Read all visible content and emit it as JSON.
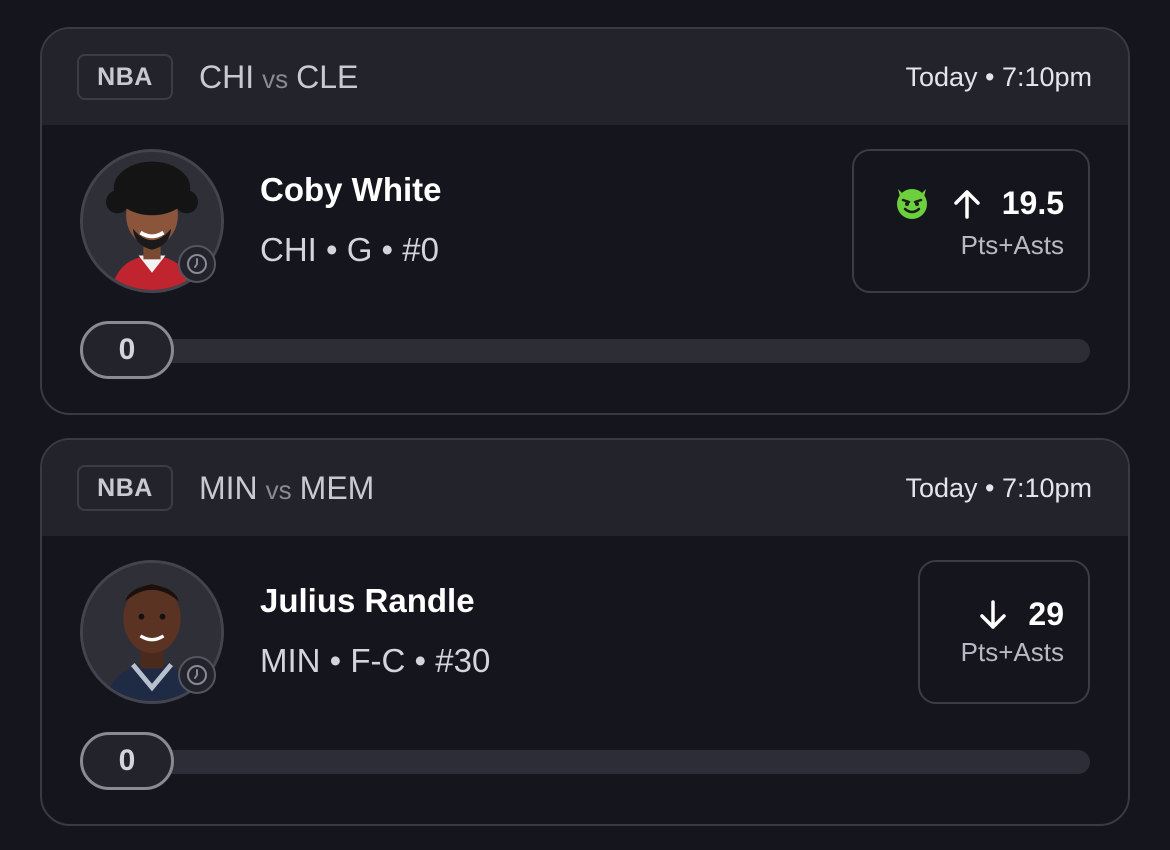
{
  "cards": [
    {
      "league": "NBA",
      "home_team": "CHI",
      "vs": "vs",
      "away_team": "CLE",
      "time": "Today • 7:10pm",
      "player": {
        "name": "Coby White",
        "meta": "CHI • G • #0"
      },
      "pick": {
        "direction": "up",
        "emoji_icon": "devil-smile-icon",
        "value": "19.5",
        "stat": "Pts+Asts"
      },
      "progress": {
        "current": "0",
        "fraction": 0
      }
    },
    {
      "league": "NBA",
      "home_team": "MIN",
      "vs": "vs",
      "away_team": "MEM",
      "time": "Today • 7:10pm",
      "player": {
        "name": "Julius Randle",
        "meta": "MIN • F-C • #30"
      },
      "pick": {
        "direction": "down",
        "value": "29",
        "stat": "Pts+Asts"
      },
      "progress": {
        "current": "0",
        "fraction": 0
      }
    }
  ],
  "colors": {
    "background": "#15151d",
    "header": "#23232c",
    "border": "#3a3a45",
    "accent_green": "#6ccf3c"
  }
}
